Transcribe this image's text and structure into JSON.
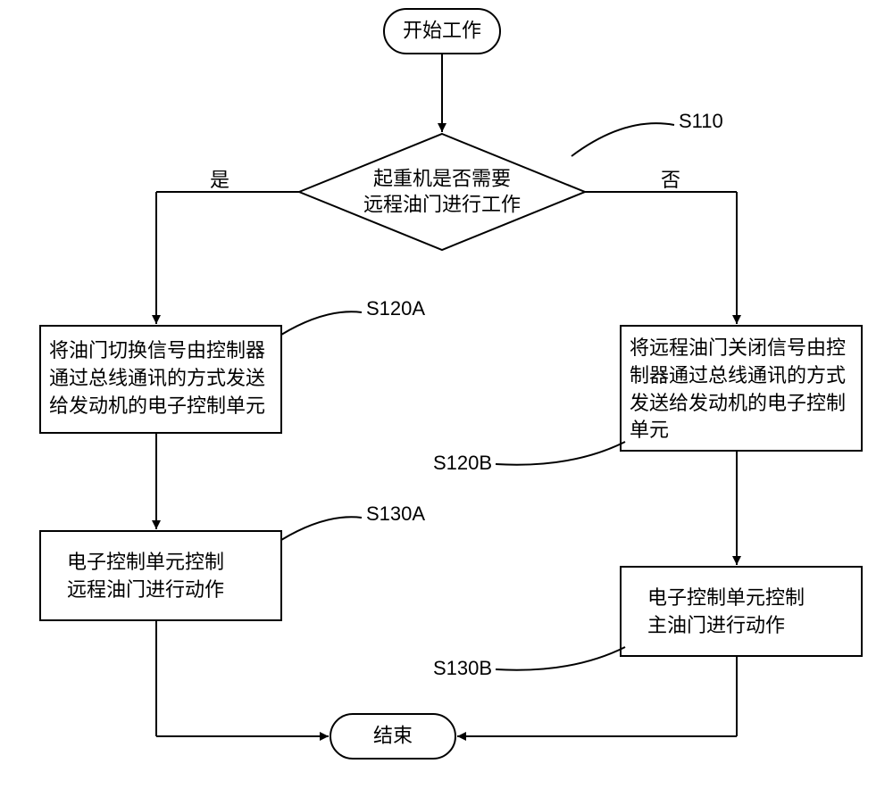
{
  "chart_data": {
    "type": "flowchart",
    "title": "",
    "nodes": [
      {
        "id": "start",
        "shape": "terminator",
        "text": "开始工作"
      },
      {
        "id": "S110",
        "shape": "decision",
        "text": "起重机是否需要\n远程油门进行工作",
        "label": "S110"
      },
      {
        "id": "S120A",
        "shape": "process",
        "text": "将油门切换信号由控制器\n通过总线通讯的方式发送\n给发动机的电子控制单元",
        "label": "S120A"
      },
      {
        "id": "S120B",
        "shape": "process",
        "text": "将远程油门关闭信号由控\n制器通过总线通讯的方式\n发送给发动机的电子控制\n单元",
        "label": "S120B"
      },
      {
        "id": "S130A",
        "shape": "process",
        "text": "电子控制单元控制\n远程油门进行动作",
        "label": "S130A"
      },
      {
        "id": "S130B",
        "shape": "process",
        "text": "电子控制单元控制\n主油门进行动作",
        "label": "S130B"
      },
      {
        "id": "end",
        "shape": "terminator",
        "text": "结束"
      }
    ],
    "edges": [
      {
        "from": "start",
        "to": "S110"
      },
      {
        "from": "S110",
        "to": "S120A",
        "label": "是"
      },
      {
        "from": "S110",
        "to": "S120B",
        "label": "否"
      },
      {
        "from": "S120A",
        "to": "S130A"
      },
      {
        "from": "S120B",
        "to": "S130B"
      },
      {
        "from": "S130A",
        "to": "end"
      },
      {
        "from": "S130B",
        "to": "end"
      }
    ]
  },
  "texts": {
    "start": "开始工作",
    "decision": "起重机是否需要\n远程油门进行工作",
    "s110label": "S110",
    "yes": "是",
    "no": "否",
    "s120a": "将油门切换信号由控制器\n通过总线通讯的方式发送\n给发动机的电子控制单元",
    "s120a_label": "S120A",
    "s120b": "将远程油门关闭信号由控\n制器通过总线通讯的方式\n发送给发动机的电子控制\n单元",
    "s120b_label": "S120B",
    "s130a": "电子控制单元控制\n远程油门进行动作",
    "s130a_label": "S130A",
    "s130b": "电子控制单元控制\n主油门进行动作",
    "s130b_label": "S130B",
    "end": "结束"
  }
}
